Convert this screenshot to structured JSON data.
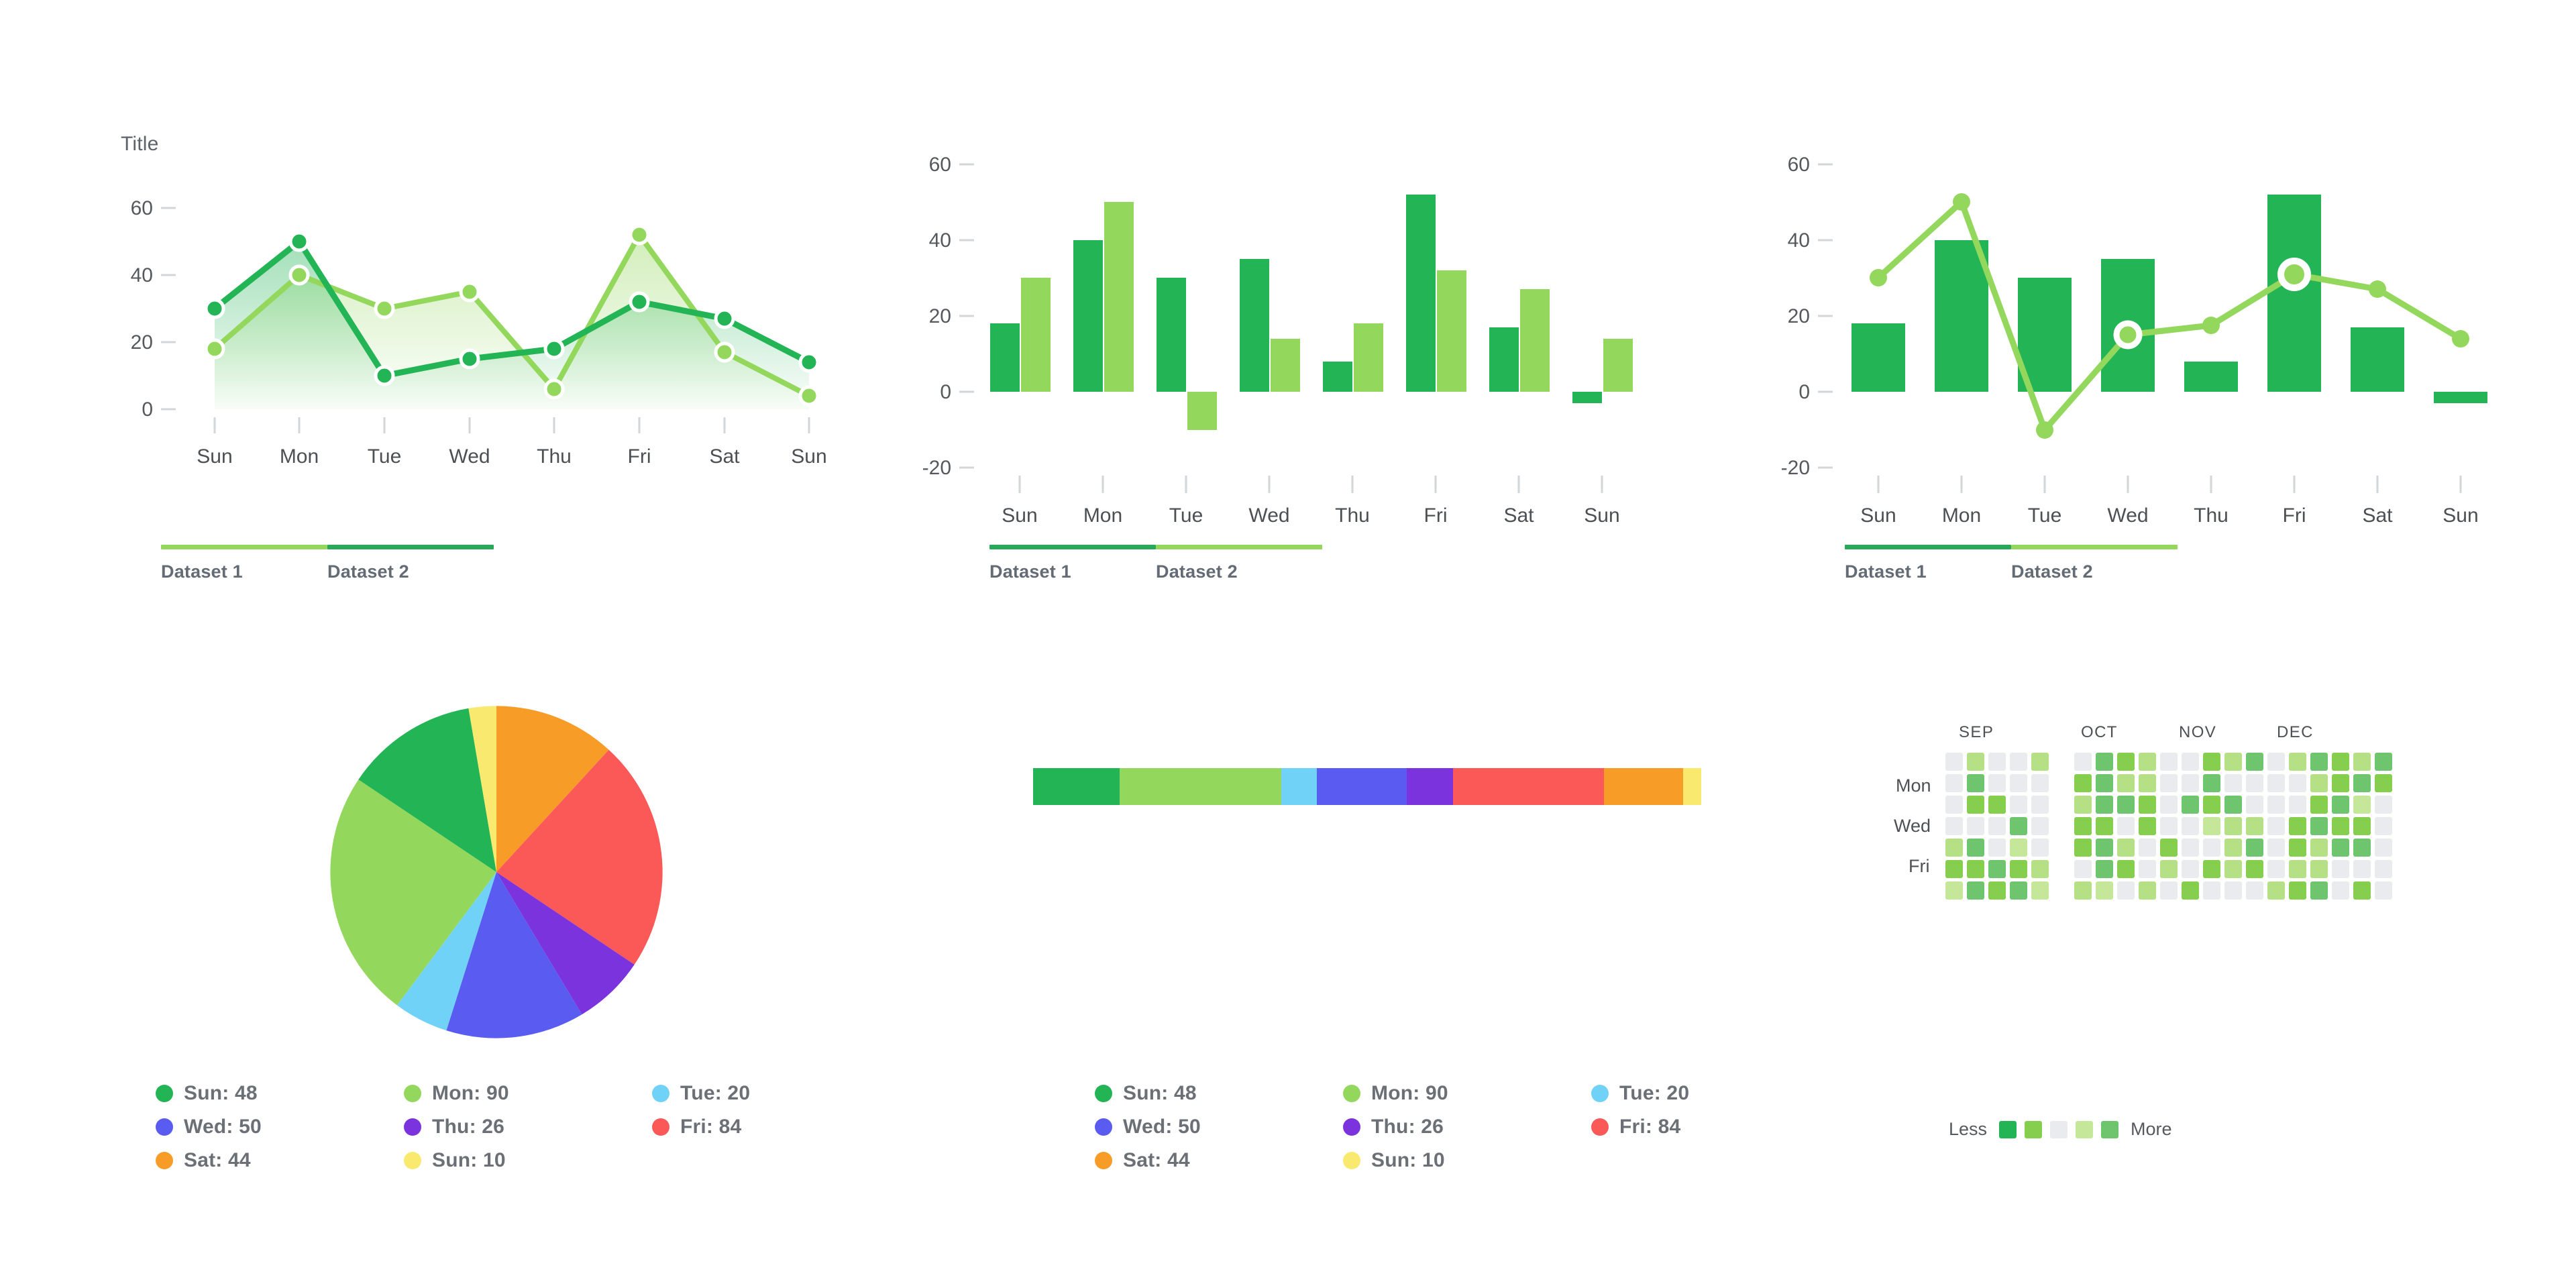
{
  "palette": {
    "dark_green": "#22b455",
    "light_green": "#93d75c",
    "light_blue": "#71d2f7",
    "blue": "#5a5bf0",
    "purple": "#7b33dd",
    "red": "#fb5858",
    "orange": "#f89c28",
    "yellow": "#fae96f",
    "heat_empty": "#e9ebee",
    "text": "#6b7077",
    "axis": "#4c5054",
    "tick": "#d3d6d9"
  },
  "charts": {
    "line": {
      "title": "Title",
      "y_ticks": [
        "60",
        "40",
        "20",
        "0"
      ],
      "x_ticks": [
        "Sun",
        "Mon",
        "Tue",
        "Wed",
        "Thu",
        "Fri",
        "Sat",
        "Sun"
      ],
      "legend": [
        {
          "label": "Dataset 1",
          "color": "#93d75c"
        },
        {
          "label": "Dataset 2",
          "color": "#22b455"
        }
      ]
    },
    "bar": {
      "y_ticks": [
        "60",
        "40",
        "20",
        "0",
        "-20"
      ],
      "x_ticks": [
        "Sun",
        "Mon",
        "Tue",
        "Wed",
        "Thu",
        "Fri",
        "Sat",
        "Sun"
      ],
      "legend": [
        {
          "label": "Dataset 1",
          "color": "#22b455"
        },
        {
          "label": "Dataset 2",
          "color": "#93d75c"
        }
      ]
    },
    "combo": {
      "y_ticks": [
        "60",
        "40",
        "20",
        "0",
        "-20"
      ],
      "x_ticks": [
        "Sun",
        "Mon",
        "Tue",
        "Wed",
        "Thu",
        "Fri",
        "Sat",
        "Sun"
      ],
      "legend": [
        {
          "label": "Dataset 1",
          "color": "#22b455"
        },
        {
          "label": "Dataset 2",
          "color": "#93d75c"
        }
      ]
    },
    "heatmap": {
      "months": [
        "SEP",
        "OCT",
        "NOV",
        "DEC"
      ],
      "day_labels": [
        "Mon",
        "Wed",
        "Fri"
      ],
      "legend_less": "Less",
      "legend_more": "More",
      "legend_swatches": [
        "#22b455",
        "#86cf4e",
        "#e9ebee",
        "#c4e79a",
        "#6ec56e"
      ]
    }
  },
  "pie_legend": [
    {
      "label": "Sun: 48",
      "color": "#22b455"
    },
    {
      "label": "Wed: 50",
      "color": "#5a5bf0"
    },
    {
      "label": "Sat: 44",
      "color": "#f89c28"
    },
    {
      "label": "Mon: 90",
      "color": "#93d75c"
    },
    {
      "label": "Thu: 26",
      "color": "#7b33dd"
    },
    {
      "label": "Sun: 10",
      "color": "#fae96f"
    },
    {
      "label": "Tue: 20",
      "color": "#71d2f7"
    },
    {
      "label": "Fri: 84",
      "color": "#fb5858"
    }
  ],
  "stack_legend": [
    {
      "label": "Sun: 48",
      "color": "#22b455"
    },
    {
      "label": "Wed: 50",
      "color": "#5a5bf0"
    },
    {
      "label": "Sat: 44",
      "color": "#f89c28"
    },
    {
      "label": "Mon: 90",
      "color": "#93d75c"
    },
    {
      "label": "Thu: 26",
      "color": "#7b33dd"
    },
    {
      "label": "Sun: 10",
      "color": "#fae96f"
    },
    {
      "label": "Tue: 20",
      "color": "#71d2f7"
    },
    {
      "label": "Fri: 84",
      "color": "#fb5858"
    }
  ],
  "chart_data": [
    {
      "type": "area",
      "title": "Title",
      "xlabel": "",
      "ylabel": "",
      "categories": [
        "Sun",
        "Mon",
        "Tue",
        "Wed",
        "Thu",
        "Fri",
        "Sat",
        "Sun"
      ],
      "ylim": [
        0,
        60
      ],
      "yticks": [
        0,
        20,
        40,
        60
      ],
      "grid": false,
      "legend_position": "bottom-left",
      "series": [
        {
          "name": "Dataset 1",
          "color": "#93d75c",
          "values": [
            18,
            40,
            30,
            35,
            8,
            52,
            17,
            4
          ]
        },
        {
          "name": "Dataset 2",
          "color": "#22b455",
          "values": [
            30,
            50,
            10,
            15,
            18,
            32,
            27,
            14
          ]
        }
      ]
    },
    {
      "type": "bar",
      "title": "",
      "xlabel": "",
      "ylabel": "",
      "categories": [
        "Sun",
        "Mon",
        "Tue",
        "Wed",
        "Thu",
        "Fri",
        "Sat",
        "Sun"
      ],
      "ylim": [
        -20,
        60
      ],
      "yticks": [
        -20,
        0,
        20,
        40,
        60
      ],
      "grid": false,
      "legend_position": "bottom-left",
      "series": [
        {
          "name": "Dataset 1",
          "color": "#22b455",
          "values": [
            18,
            40,
            30,
            35,
            8,
            52,
            17,
            -3
          ]
        },
        {
          "name": "Dataset 2",
          "color": "#93d75c",
          "values": [
            30,
            50,
            -10,
            14,
            18,
            32,
            27,
            14
          ]
        }
      ]
    },
    {
      "type": "bar",
      "title": "",
      "xlabel": "",
      "ylabel": "",
      "categories": [
        "Sun",
        "Mon",
        "Tue",
        "Wed",
        "Thu",
        "Fri",
        "Sat",
        "Sun"
      ],
      "ylim": [
        -20,
        60
      ],
      "yticks": [
        -20,
        0,
        20,
        40,
        60
      ],
      "grid": false,
      "legend_position": "bottom-left",
      "series": [
        {
          "name": "Dataset 1",
          "type": "bar",
          "color": "#22b455",
          "values": [
            18,
            40,
            30,
            35,
            8,
            52,
            17,
            -3
          ]
        },
        {
          "name": "Dataset 2",
          "type": "line",
          "color": "#93d75c",
          "values": [
            30,
            50,
            -10,
            15,
            18,
            32,
            27,
            14
          ],
          "highlight_points": [
            "Wed",
            "Fri"
          ]
        }
      ]
    },
    {
      "type": "pie",
      "title": "",
      "labels": [
        "Sat",
        "Fri",
        "Thu",
        "Wed",
        "Tue",
        "Mon",
        "Sun",
        "Sun"
      ],
      "values": [
        44,
        84,
        26,
        50,
        20,
        90,
        48,
        10
      ],
      "colors": [
        "#f89c28",
        "#fb5858",
        "#7b33dd",
        "#5a5bf0",
        "#71d2f7",
        "#93d75c",
        "#22b455",
        "#fae96f"
      ],
      "legend_position": "bottom"
    },
    {
      "type": "bar",
      "orientation": "horizontal-stacked",
      "title": "",
      "labels": [
        "Sun",
        "Mon",
        "Tue",
        "Wed",
        "Thu",
        "Fri",
        "Sat",
        "Sun"
      ],
      "values": [
        48,
        90,
        20,
        50,
        26,
        84,
        44,
        10
      ],
      "colors": [
        "#22b455",
        "#93d75c",
        "#71d2f7",
        "#5a5bf0",
        "#7b33dd",
        "#fb5858",
        "#f89c28",
        "#fae96f"
      ],
      "legend_position": "bottom"
    },
    {
      "type": "heatmap",
      "title": "",
      "xlabel": "",
      "ylabel": "",
      "xticks": [
        "SEP",
        "OCT",
        "NOV",
        "DEC"
      ],
      "yticks": [
        "Mon",
        "Wed",
        "Fri"
      ],
      "legend": {
        "low": "Less",
        "high": "More"
      },
      "weeks": 19,
      "days_per_week": 7,
      "values": [
        [
          0,
          0,
          0,
          0,
          2,
          3,
          1
        ],
        [
          2,
          4,
          3,
          0,
          4,
          3,
          4
        ],
        [
          0,
          0,
          3,
          0,
          0,
          4,
          3
        ],
        [
          0,
          0,
          0,
          4,
          1,
          3,
          4
        ],
        [
          2,
          0,
          0,
          0,
          0,
          2,
          1
        ],
        [
          0,
          0,
          0,
          0,
          0,
          0,
          0
        ],
        [
          0,
          3,
          2,
          3,
          3,
          0,
          2
        ],
        [
          4,
          4,
          4,
          3,
          4,
          4,
          1
        ],
        [
          3,
          2,
          4,
          0,
          2,
          3,
          0
        ],
        [
          2,
          2,
          3,
          3,
          0,
          0,
          2
        ],
        [
          0,
          0,
          0,
          0,
          3,
          2,
          0
        ],
        [
          0,
          0,
          4,
          0,
          0,
          0,
          3
        ],
        [
          3,
          4,
          3,
          1,
          0,
          3,
          0
        ],
        [
          2,
          0,
          4,
          2,
          2,
          2,
          0
        ],
        [
          4,
          0,
          0,
          2,
          4,
          3,
          0
        ],
        [
          0,
          0,
          0,
          0,
          0,
          0,
          2
        ],
        [
          2,
          0,
          0,
          3,
          3,
          2,
          3
        ],
        [
          4,
          2,
          3,
          4,
          2,
          2,
          4
        ],
        [
          3,
          3,
          4,
          3,
          4,
          0,
          0
        ],
        [
          2,
          4,
          1,
          3,
          4,
          0,
          3
        ],
        [
          4,
          3,
          0,
          0,
          0,
          0,
          0
        ]
      ]
    }
  ]
}
